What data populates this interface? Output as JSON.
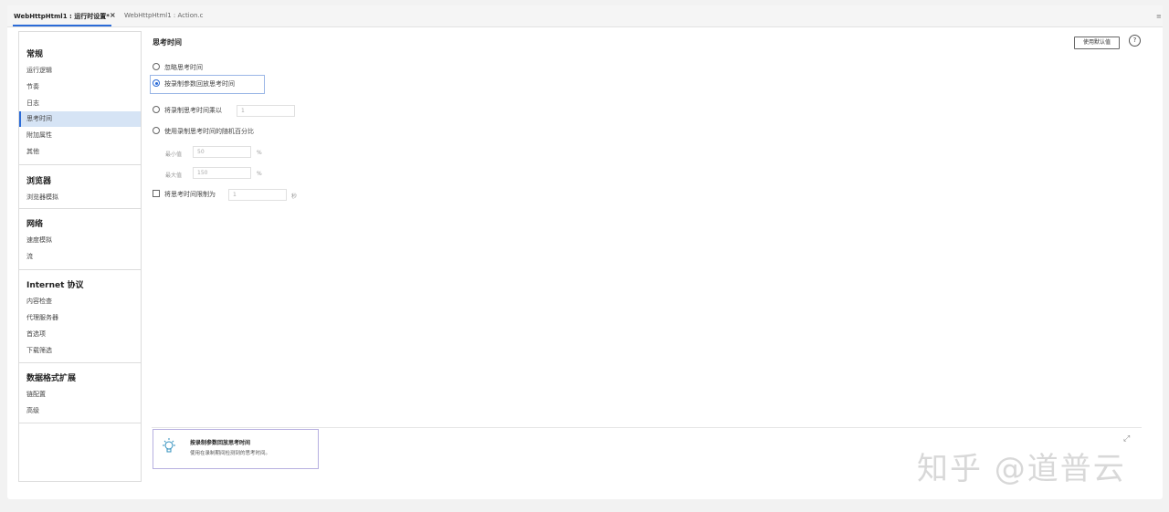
{
  "tabs": [
    {
      "label": "WebHttpHtml1 : 运行时设置*",
      "close": "×",
      "active": true
    },
    {
      "label": "WebHttpHtml1 : Action.c",
      "active": false
    }
  ],
  "tab_menu": "≡",
  "sidebar": {
    "groups": [
      {
        "title": "常规",
        "items": [
          "运行逻辑",
          "节奏",
          "日志",
          "思考时间",
          "附加属性",
          "其他"
        ]
      },
      {
        "title": "浏览器",
        "items": [
          "浏览器模拟"
        ]
      },
      {
        "title": "网络",
        "items": [
          "速度模拟",
          "流"
        ]
      },
      {
        "title": "Internet 协议",
        "items": [
          "内容检查",
          "代理服务器",
          "首选项",
          "下载筛选"
        ]
      },
      {
        "title": "数据格式扩展",
        "items": [
          "链配置",
          "高级"
        ]
      }
    ],
    "selected": "思考时间"
  },
  "main": {
    "title": "思考时间",
    "defaults_button": "使用默认值",
    "help": "?",
    "options": {
      "ignore": "忽略思考时间",
      "replay_recorded": "按录制参数回放思考时间",
      "multiply": "将录制思考时间乘以",
      "multiply_value": "1",
      "random_percent": "使用录制思考时间的随机百分比",
      "min_label": "最小值",
      "min_value": "50",
      "max_label": "最大值",
      "max_value": "150",
      "percent": "%",
      "limit": "将思考时间限制为",
      "limit_value": "1",
      "seconds": "秒"
    },
    "selected_option": "replay_recorded"
  },
  "info": {
    "title": "按录制参数回放思考时间",
    "description": "使用在录制期间检测到的思考时间。"
  },
  "watermark": "知乎 @道普云",
  "colors": {
    "accent": "#2b6bd7",
    "selected_bg": "#d6e4f5",
    "info_border": "#b7b0e0"
  }
}
